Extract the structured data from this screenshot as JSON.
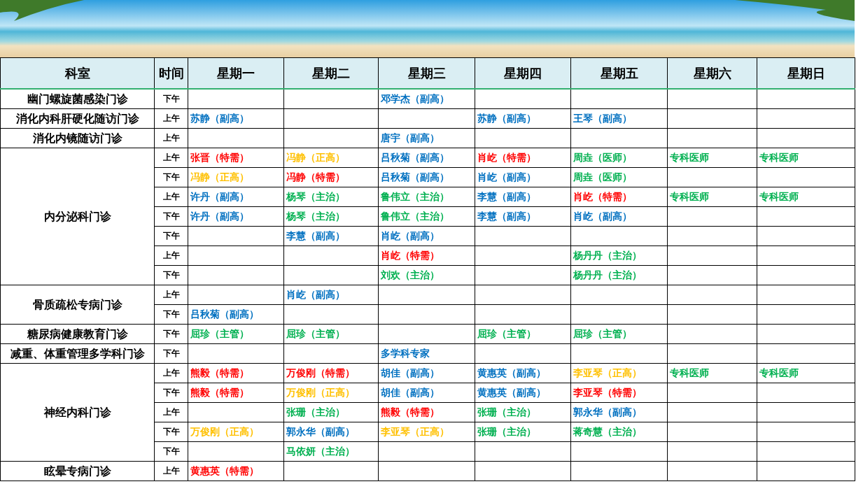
{
  "table": {
    "columns": [
      "科室",
      "时间",
      "星期一",
      "星期二",
      "星期三",
      "星期四",
      "星期五",
      "星期六",
      "星期日"
    ],
    "departments": [
      {
        "name": "幽门螺旋菌感染门诊",
        "slots": [
          {
            "time": "下午",
            "cells": [
              null,
              null,
              {
                "text": "邓学杰（副高）",
                "color": "#0070c0"
              },
              null,
              null,
              null,
              null
            ]
          }
        ]
      },
      {
        "name": "消化内科肝硬化随访门诊",
        "slots": [
          {
            "time": "上午",
            "cells": [
              {
                "text": "苏静（副高）",
                "color": "#0070c0"
              },
              null,
              null,
              {
                "text": "苏静（副高）",
                "color": "#0070c0"
              },
              {
                "text": "王琴（副高）",
                "color": "#0070c0"
              },
              null,
              null
            ]
          }
        ]
      },
      {
        "name": "消化内镜随访门诊",
        "slots": [
          {
            "time": "上午",
            "cells": [
              null,
              null,
              {
                "text": "唐宇（副高）",
                "color": "#0070c0"
              },
              null,
              null,
              null,
              null
            ]
          }
        ]
      },
      {
        "name": "内分泌科门诊",
        "slots": [
          {
            "time": "上午",
            "cells": [
              {
                "text": "张晋（特需）",
                "color": "#ff0000"
              },
              {
                "text": "冯静（正高）",
                "color": "#ffc000"
              },
              {
                "text": "吕秋菊（副高）",
                "color": "#0070c0"
              },
              {
                "text": "肖屹（特需）",
                "color": "#ff0000"
              },
              {
                "text": "周垚（医师）",
                "color": "#00b050"
              },
              {
                "text": "专科医师",
                "color": "#00b050"
              },
              {
                "text": "专科医师",
                "color": "#00b050"
              }
            ]
          },
          {
            "time": "下午",
            "cells": [
              {
                "text": "冯静（正高）",
                "color": "#ffc000"
              },
              {
                "text": "冯静（特需）",
                "color": "#ff0000"
              },
              {
                "text": "吕秋菊（副高）",
                "color": "#0070c0"
              },
              {
                "text": "肖屹（副高）",
                "color": "#0070c0"
              },
              {
                "text": "周垚（医师）",
                "color": "#00b050"
              },
              null,
              null
            ]
          },
          {
            "time": "上午",
            "cells": [
              {
                "text": "许丹（副高）",
                "color": "#0070c0"
              },
              {
                "text": "杨琴（主治）",
                "color": "#00b050"
              },
              {
                "text": "鲁伟立（主治）",
                "color": "#00b050"
              },
              {
                "text": "李慧（副高）",
                "color": "#0070c0"
              },
              {
                "text": "肖屹（特需）",
                "color": "#ff0000"
              },
              {
                "text": "专科医师",
                "color": "#00b050"
              },
              {
                "text": "专科医师",
                "color": "#00b050"
              }
            ]
          },
          {
            "time": "下午",
            "cells": [
              {
                "text": "许丹（副高）",
                "color": "#0070c0"
              },
              {
                "text": "杨琴（主治）",
                "color": "#00b050"
              },
              {
                "text": "鲁伟立（主治）",
                "color": "#00b050"
              },
              {
                "text": "李慧（副高）",
                "color": "#0070c0"
              },
              {
                "text": "肖屹（副高）",
                "color": "#0070c0"
              },
              null,
              null
            ]
          },
          {
            "time": "下午",
            "cells": [
              null,
              {
                "text": "李慧（副高）",
                "color": "#0070c0"
              },
              {
                "text": "肖屹（副高）",
                "color": "#0070c0"
              },
              null,
              null,
              null,
              null
            ]
          },
          {
            "time": "上午",
            "cells": [
              null,
              null,
              {
                "text": "肖屹（特需）",
                "color": "#ff0000"
              },
              null,
              {
                "text": "杨丹丹（主治）",
                "color": "#00b050"
              },
              null,
              null
            ]
          },
          {
            "time": "下午",
            "cells": [
              null,
              null,
              {
                "text": "刘欢（主治）",
                "color": "#00b050"
              },
              null,
              {
                "text": "杨丹丹（主治）",
                "color": "#00b050"
              },
              null,
              null
            ]
          }
        ]
      },
      {
        "name": "骨质疏松专病门诊",
        "slots": [
          {
            "time": "上午",
            "cells": [
              null,
              {
                "text": "肖屹（副高）",
                "color": "#0070c0"
              },
              null,
              null,
              null,
              null,
              null
            ]
          },
          {
            "time": "下午",
            "cells": [
              {
                "text": "吕秋菊（副高）",
                "color": "#0070c0"
              },
              null,
              null,
              null,
              null,
              null,
              null
            ]
          }
        ]
      },
      {
        "name": "糖尿病健康教育门诊",
        "slots": [
          {
            "time": "下午",
            "cells": [
              {
                "text": "屈珍（主管）",
                "color": "#00b050"
              },
              {
                "text": "屈珍（主管）",
                "color": "#00b050"
              },
              null,
              {
                "text": "屈珍（主管）",
                "color": "#00b050"
              },
              {
                "text": "屈珍（主管）",
                "color": "#00b050"
              },
              null,
              null
            ]
          }
        ]
      },
      {
        "name": "减重、体重管理多学科门诊",
        "slots": [
          {
            "time": "下午",
            "cells": [
              null,
              null,
              {
                "text": "多学科专家",
                "color": "#0070c0"
              },
              null,
              null,
              null,
              null
            ]
          }
        ]
      },
      {
        "name": "神经内科门诊",
        "slots": [
          {
            "time": "上午",
            "cells": [
              {
                "text": "熊毅（特需）",
                "color": "#ff0000"
              },
              {
                "text": "万俊刚（特需）",
                "color": "#ff0000"
              },
              {
                "text": "胡佳（副高）",
                "color": "#0070c0"
              },
              {
                "text": "黄惠英（副高）",
                "color": "#0070c0"
              },
              {
                "text": "李亚琴（正高）",
                "color": "#ffc000"
              },
              {
                "text": "专科医师",
                "color": "#00b050"
              },
              {
                "text": "专科医师",
                "color": "#00b050"
              }
            ]
          },
          {
            "time": "下午",
            "cells": [
              {
                "text": "熊毅（特需）",
                "color": "#ff0000"
              },
              {
                "text": "万俊刚（正高）",
                "color": "#ffc000"
              },
              {
                "text": "胡佳（副高）",
                "color": "#0070c0"
              },
              {
                "text": "黄惠英（副高）",
                "color": "#0070c0"
              },
              {
                "text": "李亚琴（特需）",
                "color": "#ff0000"
              },
              null,
              null
            ]
          },
          {
            "time": "上午",
            "cells": [
              null,
              {
                "text": "张珊（主治）",
                "color": "#00b050"
              },
              {
                "text": "熊毅（特需）",
                "color": "#ff0000"
              },
              {
                "text": "张珊（主治）",
                "color": "#00b050"
              },
              {
                "text": "郭永华（副高）",
                "color": "#0070c0"
              },
              null,
              null
            ]
          },
          {
            "time": "下午",
            "cells": [
              {
                "text": "万俊刚（正高）",
                "color": "#ffc000"
              },
              {
                "text": "郭永华（副高）",
                "color": "#0070c0"
              },
              {
                "text": "李亚琴（正高）",
                "color": "#ffc000"
              },
              {
                "text": "张珊（主治）",
                "color": "#00b050"
              },
              {
                "text": "蒋奇慧（主治）",
                "color": "#00b050"
              },
              null,
              null
            ]
          },
          {
            "time": "下午",
            "cells": [
              null,
              {
                "text": "马依妍（主治）",
                "color": "#00b050"
              },
              null,
              null,
              null,
              null,
              null
            ]
          }
        ]
      },
      {
        "name": "眩晕专病门诊",
        "slots": [
          {
            "time": "上午",
            "cells": [
              {
                "text": "黄惠英（特需）",
                "color": "#ff0000"
              },
              null,
              null,
              null,
              null,
              null,
              null
            ]
          }
        ]
      }
    ]
  }
}
